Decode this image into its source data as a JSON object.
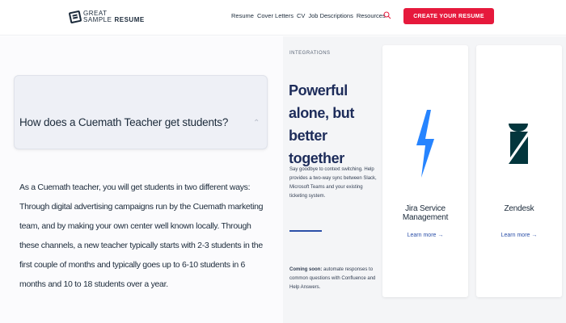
{
  "header": {
    "logo": {
      "line1": "GREAT",
      "line2a": "SAMPLE",
      "line2b": "RESUME"
    },
    "nav": [
      {
        "label": "Resume"
      },
      {
        "label": "Cover Letters"
      },
      {
        "label": "CV"
      },
      {
        "label": "Job Descriptions"
      },
      {
        "label": "Resources"
      }
    ],
    "search_icon": "search-icon",
    "cta_label": "CREATE YOUR RESUME"
  },
  "faq": {
    "question": "How does a Cuemath Teacher get students?",
    "answer": "As a Cuemath teacher, you will get students in two different ways: Through digital advertising campaigns run by the Cuemath marketing team, and by making your own center well known locally. Through these channels, a new teacher typically starts with 2-3 students in the first couple of months and typically goes up to 6-10 students in 6 months and 10 to 18 students over a year."
  },
  "integrations": {
    "eyebrow": "INTEGRATIONS",
    "heading": "Powerful alone, but better together",
    "description": "Say goodbye to context switching. Help provides a two-way sync between Slack, Microsoft Teams and your existing ticketing system.",
    "coming_bold": "Coming soon:",
    "coming_text": " automate responses to common questions with Confluence and Help Answers.",
    "cards": [
      {
        "title": "Jira Service Management",
        "link": "Learn more →",
        "icon": "jira-logo-icon"
      },
      {
        "title": "Zendesk",
        "link": "Learn more →",
        "icon": "zendesk-logo-icon"
      }
    ]
  },
  "colors": {
    "cta": "#e6193c",
    "jira_blue": "#2684ff",
    "zendesk_dark": "#03363d",
    "heading_navy": "#1d2c5a",
    "link_blue": "#2b4fa8"
  }
}
